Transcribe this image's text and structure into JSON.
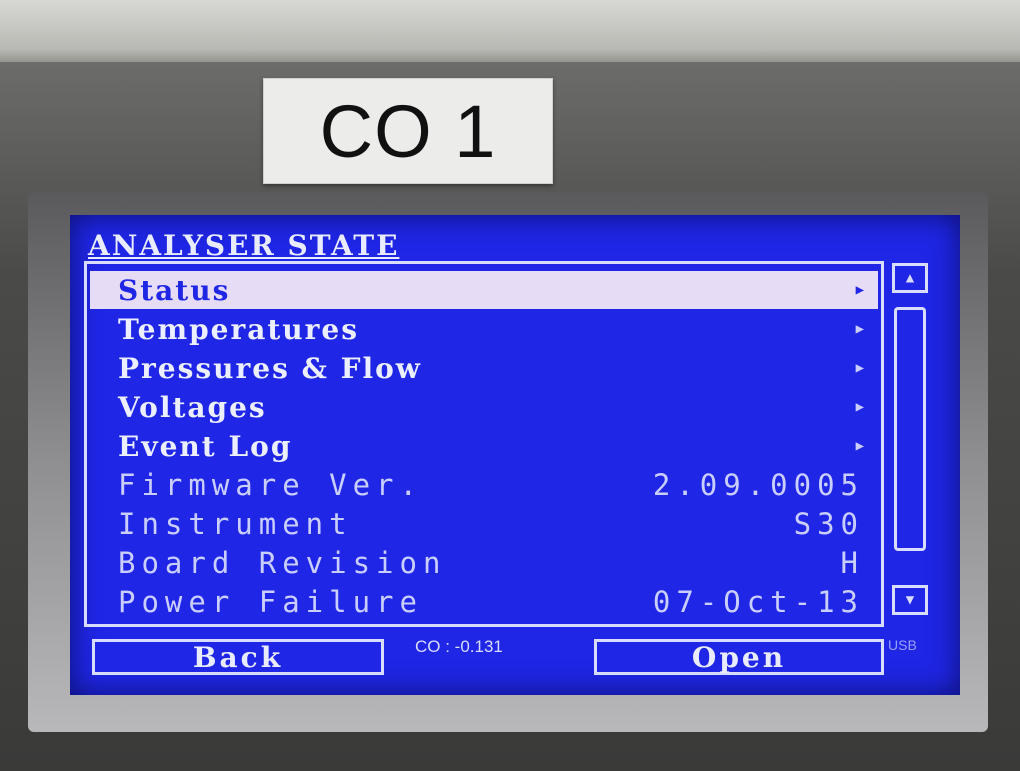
{
  "label_sticker": "CO 1",
  "screen": {
    "title": "ANALYSER STATE",
    "menu_items": [
      {
        "label": "Status",
        "value": "",
        "has_arrow": true,
        "selected": true
      },
      {
        "label": "Temperatures",
        "value": "",
        "has_arrow": true,
        "selected": false
      },
      {
        "label": "Pressures & Flow",
        "value": "",
        "has_arrow": true,
        "selected": false
      },
      {
        "label": "Voltages",
        "value": "",
        "has_arrow": true,
        "selected": false
      },
      {
        "label": "Event Log",
        "value": "",
        "has_arrow": true,
        "selected": false
      },
      {
        "label": "Firmware Ver.",
        "value": "2.09.0005",
        "has_arrow": false,
        "selected": false
      },
      {
        "label": "Instrument",
        "value": "S30",
        "has_arrow": false,
        "selected": false
      },
      {
        "label": "Board Revision",
        "value": "H",
        "has_arrow": false,
        "selected": false
      },
      {
        "label": "Power Failure",
        "value": "07-Oct-13",
        "has_arrow": false,
        "selected": false
      }
    ],
    "back_label": "Back",
    "open_label": "Open",
    "reading": "CO : -0.131",
    "usb_indicator": "USB",
    "colors": {
      "screen_bg": "#1f26e6",
      "text": "#e9ecff",
      "selection": "#e6dcf5"
    }
  }
}
